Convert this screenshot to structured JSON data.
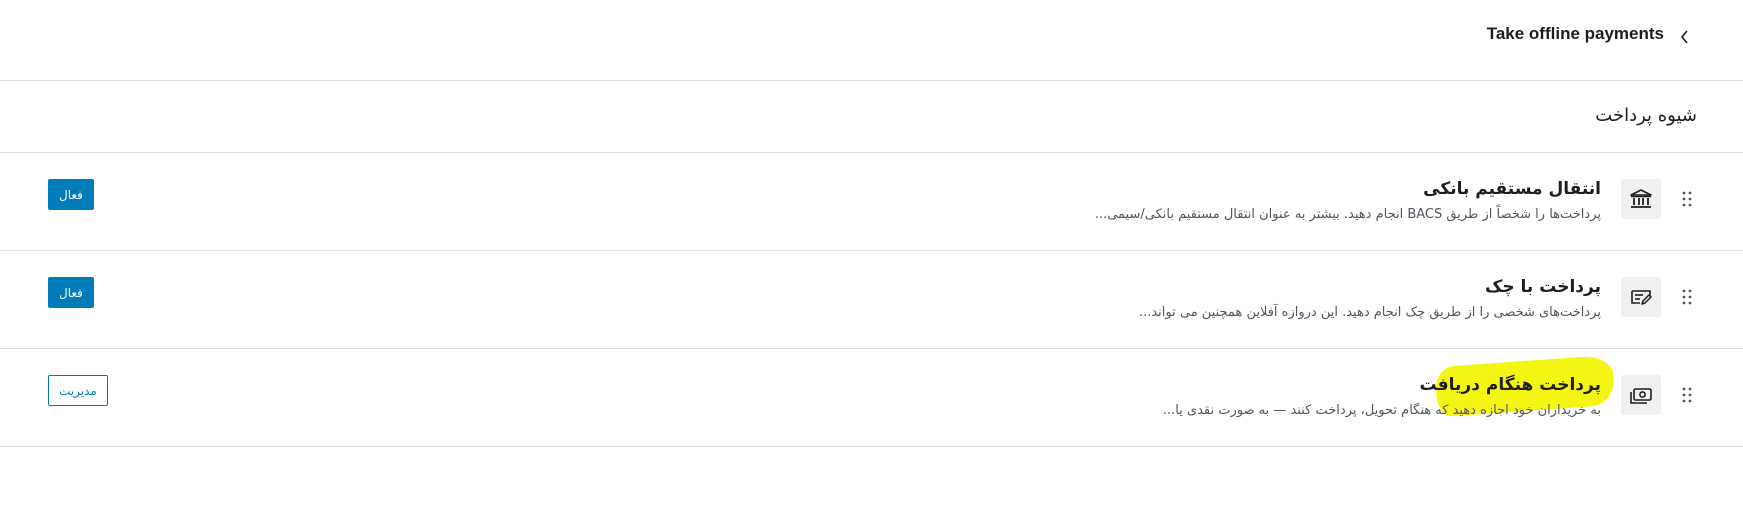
{
  "header": {
    "title": "Take offline payments",
    "back_icon": "chevron-left-icon"
  },
  "section": {
    "title": "شیوه پرداخت"
  },
  "gateways": [
    {
      "title": "انتقال مستقیم بانکی",
      "description": "پرداخت‌ها را شخصاً از طریق BACS انجام دهید. بیشتر به عنوان انتقال مستقیم بانکی/سیمی...",
      "icon": "bank-icon",
      "button_label": "فعال",
      "button_style": "primary"
    },
    {
      "title": "پرداخت با چک",
      "description": "پرداخت‌های شخصی را از طریق چک انجام دهید. این دروازه آفلاین همچنین می تواند...",
      "icon": "cheque-icon",
      "button_label": "فعال",
      "button_style": "primary"
    },
    {
      "title": "پرداخت هنگام دریافت",
      "description": "به خریداران خود اجازه دهید که هنگام تحویل، پرداخت کنند — به صورت نقدی یا...",
      "icon": "cash-icon",
      "button_label": "مدیریت",
      "button_style": "secondary",
      "highlighted": true
    }
  ],
  "colors": {
    "accent": "#007cba",
    "highlight": "#f5f513",
    "divider": "#e0e0e0",
    "icon_bg": "#f0f0f0"
  }
}
